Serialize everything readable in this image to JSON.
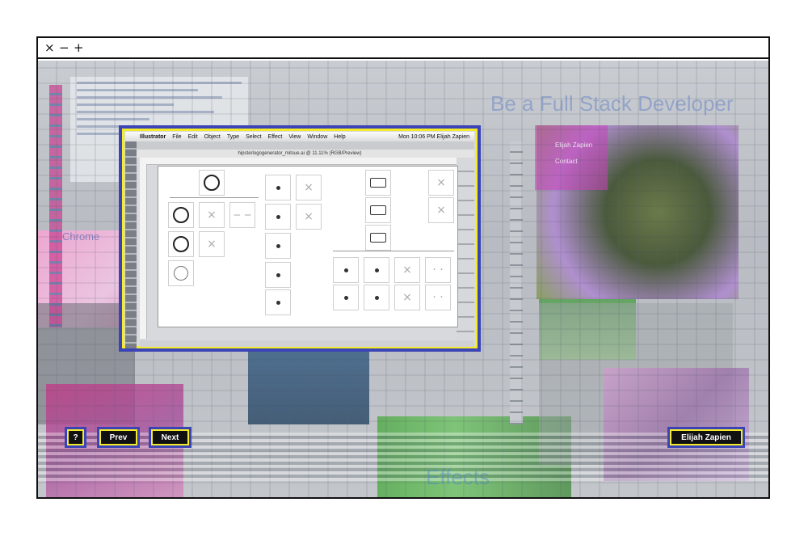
{
  "window": {
    "controls": {
      "close": "×",
      "minimize": "−",
      "maximize": "+"
    }
  },
  "background_text": {
    "headline": "Be a Full Stack Developer",
    "chrome_label": "Chrome",
    "name_label": "Elijah Zapien",
    "contact_label": "Contact",
    "effects_label": "Effects"
  },
  "illustrator": {
    "menu": [
      "Illustrator",
      "File",
      "Edit",
      "Object",
      "Type",
      "Select",
      "Effect",
      "View",
      "Window",
      "Help"
    ],
    "clock": "Mon 10:06 PM  Elijah Zapien",
    "doc_title": "hipsterlogogenerator_mitsue.ai @ 11.11% (RGB/Preview)"
  },
  "nav": {
    "help_label": "?",
    "prev_label": "Prev",
    "next_label": "Next",
    "author_label": "Elijah Zapien"
  }
}
